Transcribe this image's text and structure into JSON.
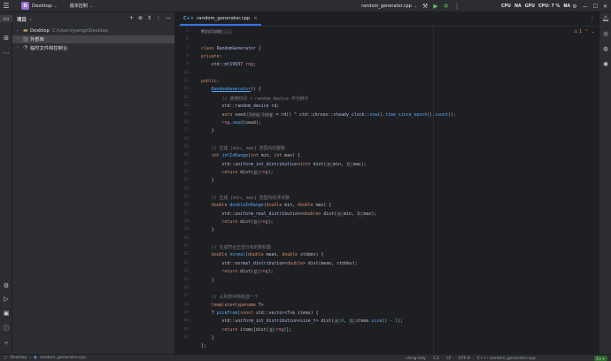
{
  "titlebar": {
    "project_badge": "D",
    "project_name": "Desktop",
    "vcs_label": "版本控制",
    "run_config": "random_generator.cpp",
    "stats": [
      "CPU",
      "NA",
      "GPU",
      "CPU: 7 %",
      "NA"
    ]
  },
  "project_panel": {
    "title": "项目",
    "tree": [
      {
        "label": "Desktop",
        "path": "C:\\Users\\yangz\\Desktop",
        "expanded": false
      },
      {
        "label": "外部库",
        "path": "",
        "expanded": false,
        "selected": true
      },
      {
        "label": "临时文件和控制台",
        "path": "",
        "expanded": false
      }
    ]
  },
  "editor": {
    "tab_label": "random_generator.cpp",
    "tab_ext": "C++",
    "warnings": "⚠ 1",
    "line_numbers": [
      "1",
      "6",
      "7",
      "8",
      "9",
      "10",
      "11",
      "12",
      "13",
      "14",
      "15",
      "16",
      "17",
      "18",
      "19",
      "20",
      "21",
      "22",
      "23",
      "24",
      "25",
      "26",
      "27",
      "28",
      "29",
      "30",
      "31",
      "32",
      "33",
      "34",
      "35",
      "36",
      "37",
      "38",
      "39",
      "40",
      "41",
      "42"
    ],
    "code": [
      "#include ...",
      "",
      "class RandomGenerator {",
      "private:",
      "    std::mt19937 rng;",
      "",
      "public:",
      "    RandomGenerator() {",
      "        // 使用时间 + random_device 作为种子",
      "        std::random_device rd;",
      "        auto seed:long long = rd() ^ std::chrono::steady_clock::now().time_since_epoch().count();",
      "        rng.seed(seed);",
      "    }",
      "",
      "    // 生成 [min, max] 范围内的整数",
      "    int intInRange(int min, int max) {",
      "        std::uniform_int_distribution<int> dist(a:min, b:max);",
      "        return dist(g:rng);",
      "    }",
      "",
      "    // 生成 [min, max] 范围内的浮点数",
      "    double doubleInRange(double min, double max) {",
      "        std::uniform_real_distribution<double> dist(a:min, b:max);",
      "        return dist(g:rng);",
      "    }",
      "",
      "    // 生成符合正态分布的随机数",
      "    double normal(double mean, double stddev) {",
      "        std::normal_distribution<double> dist(mean, stddev);",
      "        return dist(g:rng);",
      "    }",
      "",
      "    // 从列表中随机选一个",
      "    template<typename T>",
      "    T pickFrom(const std::vector<T>& items) {",
      "        std::uniform_int_distribution<size_t> dist(a:0, b:items.size() - 1);",
      "        return items[dist(g:rng)];",
      "    }",
      "};"
    ]
  },
  "statusbar": {
    "breadcrumb_root": "Desktop",
    "breadcrumb_file": "random_generator.cpp",
    "items": [
      "clang-tidy",
      "1:1",
      "LF",
      "UTF-8",
      "C++: random_generator.cpp"
    ],
    "badge": "C++"
  },
  "colors": {
    "accent": "#3574f0",
    "background": "#1e1f22",
    "panel": "#2b2d30",
    "keyword": "#cf8e6d",
    "function": "#56a8f5",
    "comment": "#7a7e85"
  }
}
